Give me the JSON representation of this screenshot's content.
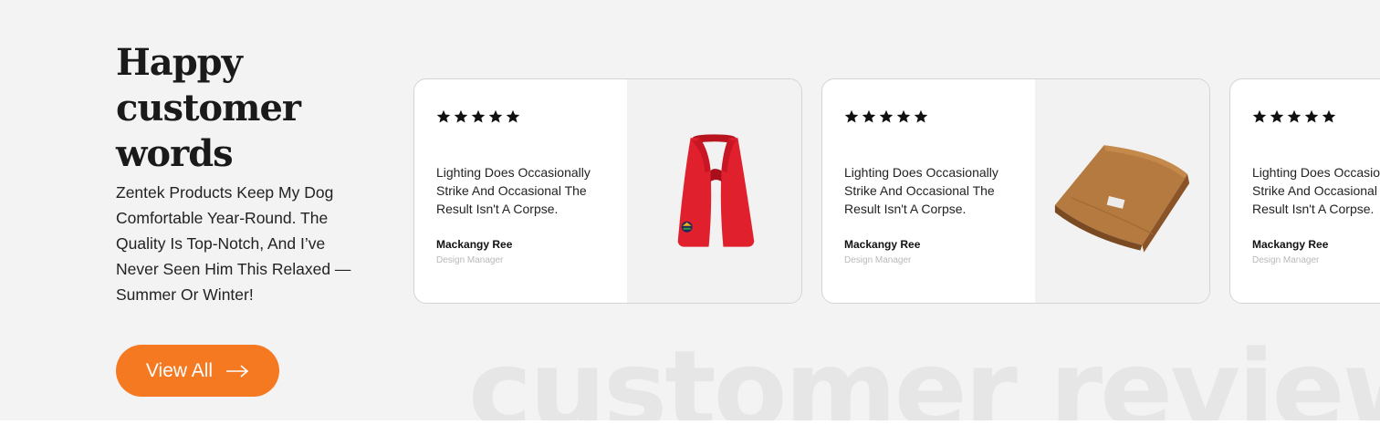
{
  "heading": "Happy customer words",
  "intro": "Zentek Products Keep My Dog Comfortable Year-Round. The Quality Is Top-Notch, And I’ve Never Seen Him This Relaxed —Summer Or Winter!",
  "view_all_label": "View All",
  "watermark": "customer review",
  "colors": {
    "accent": "#f47920",
    "background": "#f3f3f3"
  },
  "reviews": [
    {
      "rating": 5,
      "quote": "Lighting Does Occasionally Strike And Occasional The Result Isn't A Corpse.",
      "author": "Mackangy Ree",
      "role": "Design Manager",
      "product_icon": "red-scarf-image"
    },
    {
      "rating": 5,
      "quote": "Lighting Does Occasionally Strike And Occasional The Result Isn't A Corpse.",
      "author": "Mackangy Ree",
      "role": "Design Manager",
      "product_icon": "brown-blanket-image"
    },
    {
      "rating": 5,
      "quote": "Lighting Does Occasionally Strike And Occasional The Result Isn't A Corpse.",
      "author": "Mackangy Ree",
      "role": "Design Manager",
      "product_icon": "product-image"
    }
  ]
}
